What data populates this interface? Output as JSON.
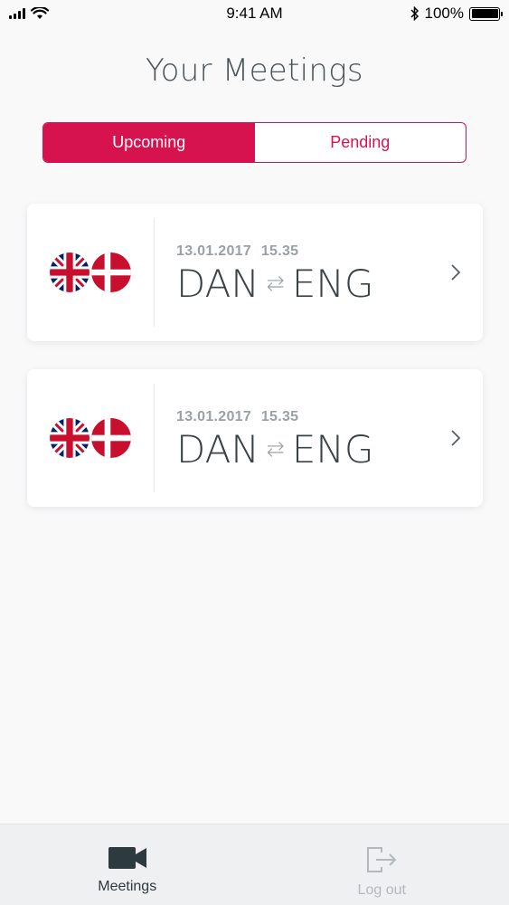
{
  "status": {
    "time": "9:41 AM",
    "battery": "100%"
  },
  "header": {
    "title": "Your Meetings"
  },
  "segments": [
    {
      "label": "Upcoming",
      "active": true
    },
    {
      "label": "Pending",
      "active": false
    }
  ],
  "meetings": [
    {
      "date": "13.01.2017",
      "time": "15.35",
      "from": "DAN",
      "swap": "⇆",
      "to": "ENG",
      "flags": [
        "uk-flag-icon",
        "denmark-flag-icon"
      ]
    },
    {
      "date": "13.01.2017",
      "time": "15.35",
      "from": "DAN",
      "swap": "⇆",
      "to": "ENG",
      "flags": [
        "uk-flag-icon",
        "denmark-flag-icon"
      ]
    }
  ],
  "tabbar": {
    "meetings_label": "Meetings",
    "logout_label": "Log out"
  },
  "colors": {
    "accent": "#d7134f",
    "text": "#3a4246",
    "muted": "#9aa1a5",
    "background": "#f9f9fa"
  },
  "icons": {
    "signal": "signal-icon",
    "wifi": "wifi-icon",
    "bluetooth": "bluetooth-icon",
    "battery": "battery-icon",
    "chevron": "chevron-right-icon",
    "meetings": "video-camera-icon",
    "logout": "logout-icon"
  }
}
